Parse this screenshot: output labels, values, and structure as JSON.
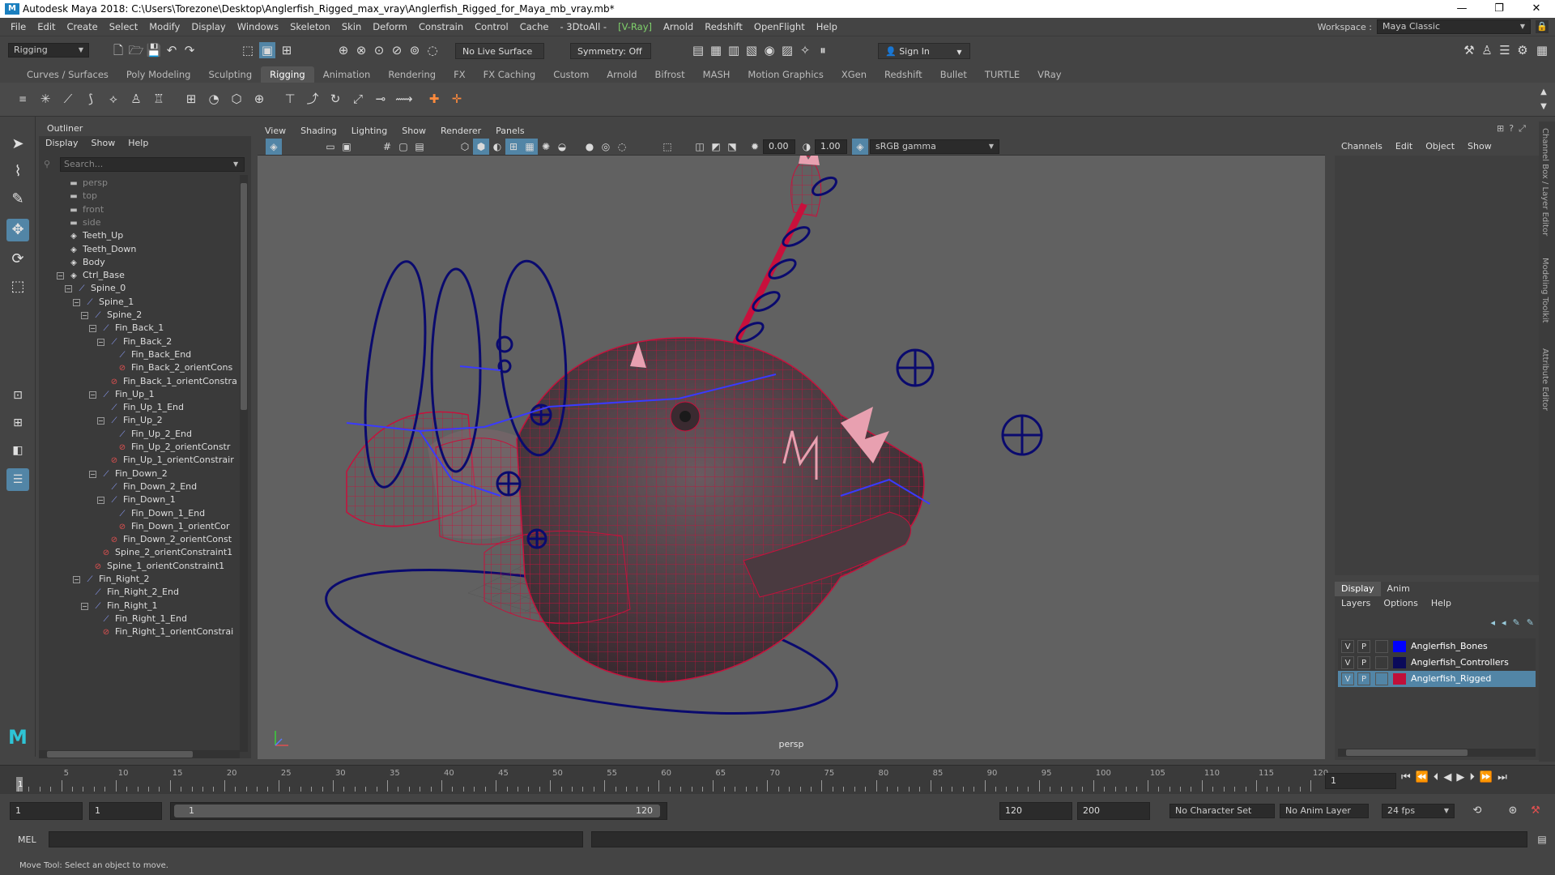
{
  "window": {
    "title": "Autodesk Maya 2018: C:\\Users\\Torezone\\Desktop\\Anglerfish_Rigged_max_vray\\Anglerfish_Rigged_for_Maya_mb_vray.mb*",
    "minimize": "—",
    "restore": "❐",
    "close": "✕"
  },
  "menu": [
    "File",
    "Edit",
    "Create",
    "Select",
    "Modify",
    "Display",
    "Windows",
    "Skeleton",
    "Skin",
    "Deform",
    "Constrain",
    "Control",
    "Cache",
    "- 3DtoAll -",
    "[V-Ray]",
    "Arnold",
    "Redshift",
    "OpenFlight",
    "Help"
  ],
  "workspace": {
    "label": "Workspace :",
    "value": "Maya Classic"
  },
  "status": {
    "menuset": "Rigging",
    "live_surface": "No Live Surface",
    "symmetry": "Symmetry: Off",
    "signin": "Sign In"
  },
  "shelf_tabs": [
    "Curves / Surfaces",
    "Poly Modeling",
    "Sculpting",
    "Rigging",
    "Animation",
    "Rendering",
    "FX",
    "FX Caching",
    "Custom",
    "Arnold",
    "Bifrost",
    "MASH",
    "Motion Graphics",
    "XGen",
    "Redshift",
    "Bullet",
    "TURTLE",
    "VRay"
  ],
  "shelf_active": "Rigging",
  "outliner": {
    "title": "Outliner",
    "menu": [
      "Display",
      "Show",
      "Help"
    ],
    "search_placeholder": "Search...",
    "items": [
      {
        "name": "persp",
        "type": "cam",
        "depth": 0
      },
      {
        "name": "top",
        "type": "cam",
        "depth": 0
      },
      {
        "name": "front",
        "type": "cam",
        "depth": 0
      },
      {
        "name": "side",
        "type": "cam",
        "depth": 0
      },
      {
        "name": "Teeth_Up",
        "type": "mesh",
        "depth": 0
      },
      {
        "name": "Teeth_Down",
        "type": "mesh",
        "depth": 0
      },
      {
        "name": "Body",
        "type": "mesh",
        "depth": 0
      },
      {
        "name": "Ctrl_Base",
        "type": "mesh",
        "depth": 0,
        "exp": true
      },
      {
        "name": "Spine_0",
        "type": "joint",
        "depth": 1,
        "exp": true
      },
      {
        "name": "Spine_1",
        "type": "joint",
        "depth": 2,
        "exp": true
      },
      {
        "name": "Spine_2",
        "type": "joint",
        "depth": 3,
        "exp": true
      },
      {
        "name": "Fin_Back_1",
        "type": "joint",
        "depth": 4,
        "exp": true
      },
      {
        "name": "Fin_Back_2",
        "type": "joint",
        "depth": 5,
        "exp": true
      },
      {
        "name": "Fin_Back_End",
        "type": "joint",
        "depth": 6
      },
      {
        "name": "Fin_Back_2_orientCons",
        "type": "cons",
        "depth": 6
      },
      {
        "name": "Fin_Back_1_orientConstra",
        "type": "cons",
        "depth": 5
      },
      {
        "name": "Fin_Up_1",
        "type": "joint",
        "depth": 4,
        "exp": true
      },
      {
        "name": "Fin_Up_1_End",
        "type": "joint",
        "depth": 5
      },
      {
        "name": "Fin_Up_2",
        "type": "joint",
        "depth": 5,
        "exp": true
      },
      {
        "name": "Fin_Up_2_End",
        "type": "joint",
        "depth": 6
      },
      {
        "name": "Fin_Up_2_orientConstr",
        "type": "cons",
        "depth": 6
      },
      {
        "name": "Fin_Up_1_orientConstrair",
        "type": "cons",
        "depth": 5
      },
      {
        "name": "Fin_Down_2",
        "type": "joint",
        "depth": 4,
        "exp": true
      },
      {
        "name": "Fin_Down_2_End",
        "type": "joint",
        "depth": 5
      },
      {
        "name": "Fin_Down_1",
        "type": "joint",
        "depth": 5,
        "exp": true
      },
      {
        "name": "Fin_Down_1_End",
        "type": "joint",
        "depth": 6
      },
      {
        "name": "Fin_Down_1_orientCor",
        "type": "cons",
        "depth": 6
      },
      {
        "name": "Fin_Down_2_orientConst",
        "type": "cons",
        "depth": 5
      },
      {
        "name": "Spine_2_orientConstraint1",
        "type": "cons",
        "depth": 4
      },
      {
        "name": "Spine_1_orientConstraint1",
        "type": "cons",
        "depth": 3
      },
      {
        "name": "Fin_Right_2",
        "type": "joint",
        "depth": 2,
        "exp": true
      },
      {
        "name": "Fin_Right_2_End",
        "type": "joint",
        "depth": 3
      },
      {
        "name": "Fin_Right_1",
        "type": "joint",
        "depth": 3,
        "exp": true
      },
      {
        "name": "Fin_Right_1_End",
        "type": "joint",
        "depth": 4
      },
      {
        "name": "Fin_Right_1_orientConstrai",
        "type": "cons",
        "depth": 4
      }
    ]
  },
  "viewport": {
    "menu": [
      "View",
      "Shading",
      "Lighting",
      "Show",
      "Renderer",
      "Panels"
    ],
    "exposure": "0.00",
    "gamma": "1.00",
    "colorspace": "sRGB gamma",
    "camera_label": "persp"
  },
  "channelbox": {
    "menu": [
      "Channels",
      "Edit",
      "Object",
      "Show"
    ]
  },
  "side_tabs": [
    "Channel Box / Layer Editor",
    "Modeling Toolkit",
    "Attribute Editor"
  ],
  "layers": {
    "tabs": [
      "Display",
      "Anim"
    ],
    "menu": [
      "Layers",
      "Options",
      "Help"
    ],
    "rows": [
      {
        "v": "V",
        "p": "P",
        "color": "#0000ff",
        "name": "Anglerfish_Bones"
      },
      {
        "v": "V",
        "p": "P",
        "color": "#0a0a5a",
        "name": "Anglerfish_Controllers"
      },
      {
        "v": "V",
        "p": "P",
        "color": "#c0103a",
        "name": "Anglerfish_Rigged"
      }
    ]
  },
  "timeline": {
    "ticks": [
      5,
      10,
      15,
      20,
      25,
      30,
      35,
      40,
      45,
      50,
      55,
      60,
      65,
      70,
      75,
      80,
      85,
      90,
      95,
      100,
      105,
      110,
      115,
      120
    ],
    "current": "1",
    "current_field": "1"
  },
  "range": {
    "start": "1",
    "anim_start": "1",
    "slider_start": "1",
    "slider_end": "120",
    "end": "120",
    "anim_end": "200",
    "character_set": "No Character Set",
    "anim_layer": "No Anim Layer",
    "fps": "24 fps"
  },
  "cmdline": {
    "label": "MEL"
  },
  "helpline": "Move Tool: Select an object to move.",
  "colors": {
    "joint": "#8fa0ff",
    "constraint": "#e05050",
    "wire": "#c8103c",
    "controller": "#0a0a6e",
    "accent": "#5285a6"
  }
}
